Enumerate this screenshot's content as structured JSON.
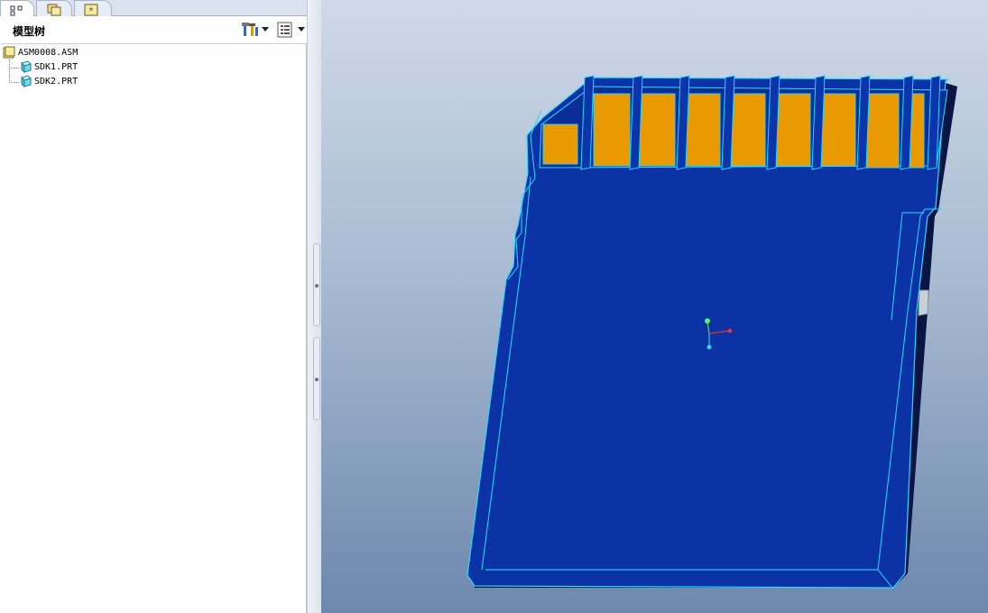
{
  "navigator": {
    "tabs": [
      {
        "name": "model-tree-tab",
        "icon": "model-tree-icon"
      },
      {
        "name": "folder-browser-tab",
        "icon": "folder-browser-icon"
      },
      {
        "name": "favorites-tab",
        "icon": "favorites-icon"
      }
    ],
    "tree_title": "模型树",
    "settings_icon": "tools-icon",
    "show_icon": "list-settings-icon"
  },
  "tree": {
    "root": {
      "label": "ASM0008.ASM",
      "icon": "assembly-icon"
    },
    "children": [
      {
        "label": "SDK1.PRT",
        "icon": "part-icon"
      },
      {
        "label": "SDK2.PRT",
        "icon": "part-icon"
      }
    ]
  },
  "viewport": {
    "background_top": "#cfd9e7",
    "background_bottom": "#6e87ad",
    "body_color": "#0b35a8",
    "edge_color": "#22d6ff",
    "contact_color": "#e89a00",
    "coordinate_axes": "csys-axes-icon"
  }
}
